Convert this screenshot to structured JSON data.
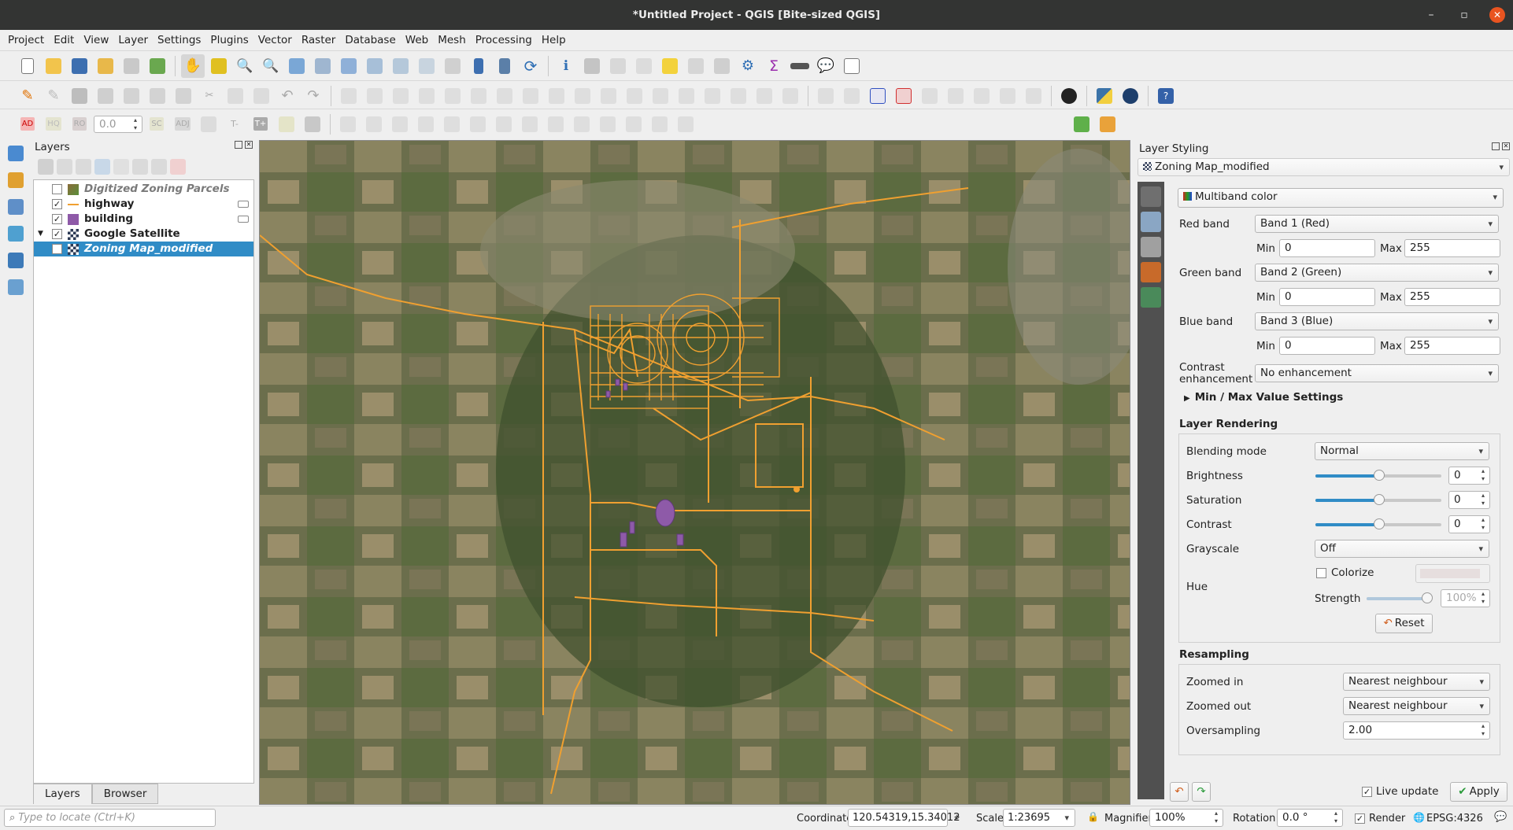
{
  "window": {
    "title": "*Untitled Project - QGIS [Bite-sized QGIS]"
  },
  "menu": [
    "Project",
    "Edit",
    "View",
    "Layer",
    "Settings",
    "Plugins",
    "Vector",
    "Raster",
    "Database",
    "Web",
    "Mesh",
    "Processing",
    "Help"
  ],
  "digitizing_toolbar": {
    "ad": "AD",
    "ro": "RO",
    "angle_value": "0.0",
    "sc": "SC",
    "adj": "ADJ",
    "t_minus": "T-",
    "t_plus": "T+"
  },
  "layers_panel": {
    "title": "Layers",
    "items": [
      {
        "name": "Digitized Zoning Parcels",
        "checked": false,
        "style": "italic-gray"
      },
      {
        "name": "highway",
        "checked": true
      },
      {
        "name": "building",
        "checked": true
      },
      {
        "name": "Google Satellite",
        "checked": true
      },
      {
        "name": "Zoning Map_modified",
        "checked": false,
        "selected": true
      }
    ],
    "tabs": [
      "Layers",
      "Browser"
    ]
  },
  "styling": {
    "title": "Layer Styling",
    "layer_selector": "Zoning Map_modified",
    "renderer": "Multiband color",
    "red_band_label": "Red band",
    "red_band": "Band 1 (Red)",
    "green_band_label": "Green band",
    "green_band": "Band 2 (Green)",
    "blue_band_label": "Blue band",
    "blue_band": "Band 3 (Blue)",
    "min_label": "Min",
    "max_label": "Max",
    "red_min": "0",
    "red_max": "255",
    "green_min": "0",
    "green_max": "255",
    "blue_min": "0",
    "blue_max": "255",
    "contrast_label_1": "Contrast",
    "contrast_label_2": "enhancement",
    "contrast": "No enhancement",
    "minmax_settings": "Min / Max Value Settings",
    "layer_rendering": "Layer Rendering",
    "blending_mode_label": "Blending mode",
    "blending_mode": "Normal",
    "brightness_label": "Brightness",
    "brightness": "0",
    "saturation_label": "Saturation",
    "saturation": "0",
    "contrast_label": "Contrast",
    "contrast_value": "0",
    "grayscale_label": "Grayscale",
    "grayscale": "Off",
    "hue_label": "Hue",
    "colorize_label": "Colorize",
    "strength_label": "Strength",
    "strength": "100%",
    "reset": "Reset",
    "resampling": "Resampling",
    "zoomed_in_label": "Zoomed in",
    "zoomed_in": "Nearest neighbour",
    "zoomed_out_label": "Zoomed out",
    "zoomed_out": "Nearest neighbour",
    "oversampling_label": "Oversampling",
    "oversampling": "2.00",
    "live_update": "Live update",
    "apply": "Apply"
  },
  "statusbar": {
    "locate_placeholder": "Type to locate (Ctrl+K)",
    "coordinate_label": "Coordinate",
    "coordinate": "120.54319,15.34012",
    "scale_label": "Scale",
    "scale": "1:23695",
    "magnifier_label": "Magnifier",
    "magnifier": "100%",
    "rotation_label": "Rotation",
    "rotation": "0.0 °",
    "render_label": "Render",
    "crs": "EPSG:4326"
  },
  "colors": {
    "accent": "#308cc6",
    "road": "#f0a030",
    "building": "#8e5aa8",
    "title_bg": "#333433"
  }
}
